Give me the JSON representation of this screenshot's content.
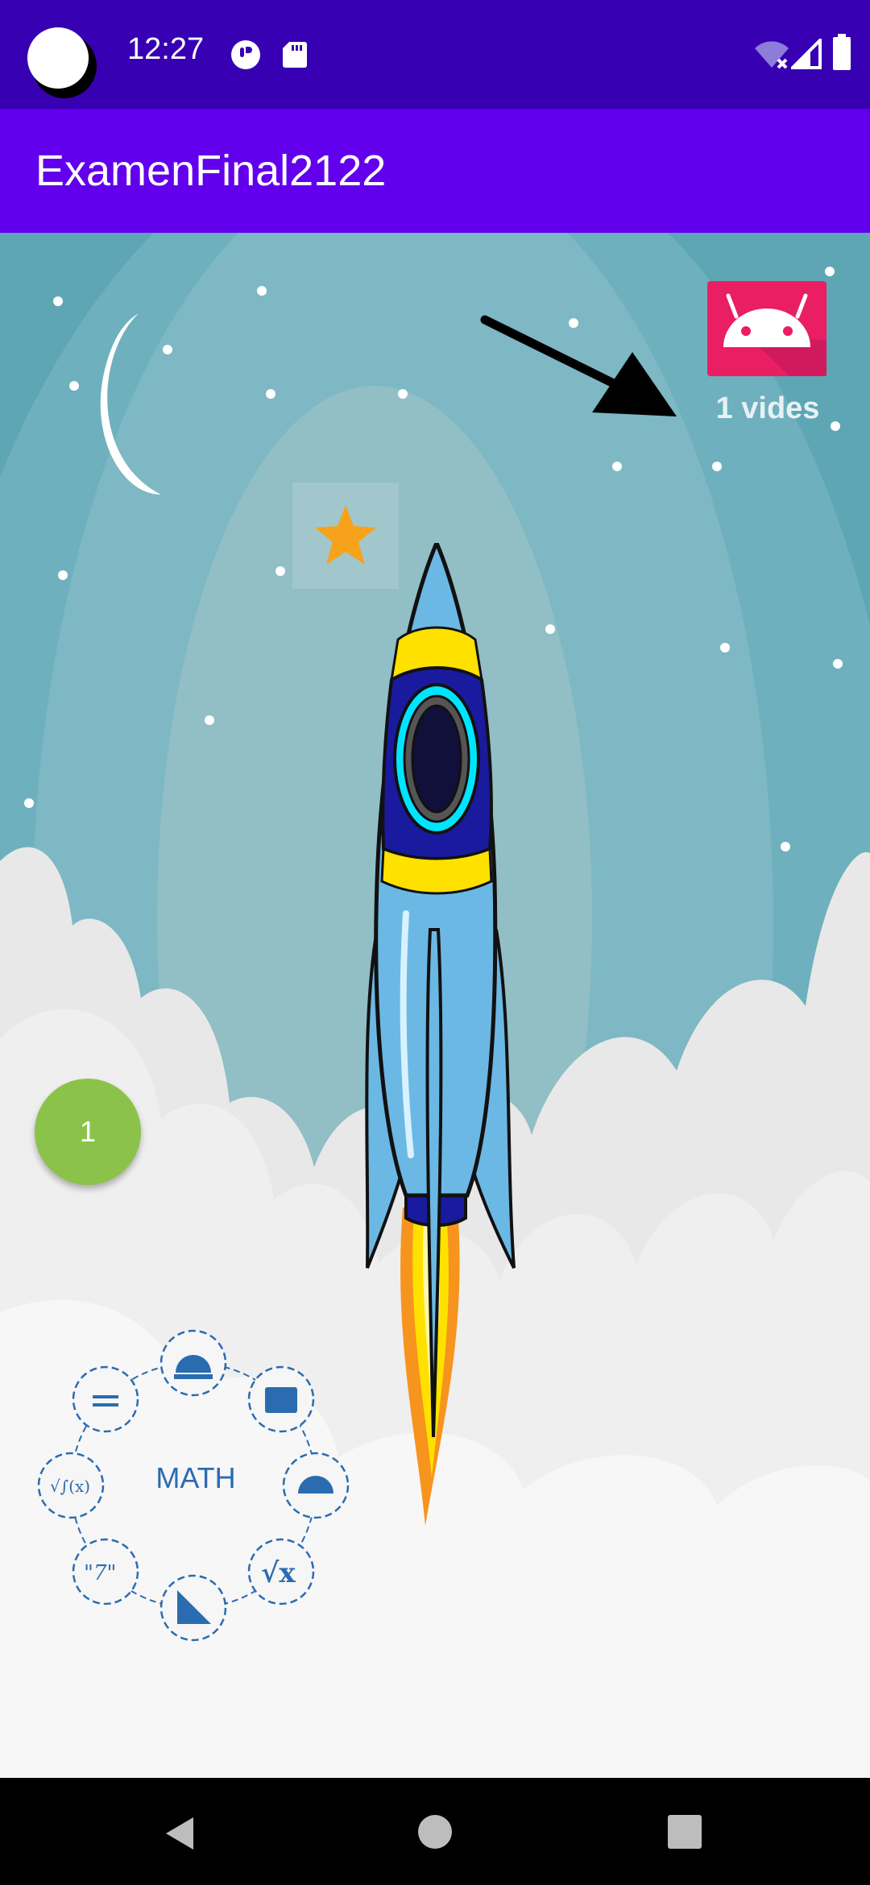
{
  "status_bar": {
    "time": "12:27",
    "icons": [
      "camera-cutout",
      "media-app-icon",
      "sd-card-icon",
      "wifi-off-icon",
      "cell-signal-icon",
      "battery-icon"
    ]
  },
  "app_bar": {
    "title": "ExamenFinal2122"
  },
  "game": {
    "lives_label": "1 vides",
    "counter": "1",
    "math_widget_label": "MATH",
    "colors": {
      "sky": "#5ea6b4",
      "counter_badge": "#8bc34a",
      "android_tile": "#e91e63",
      "star": "#f7a21b",
      "math_blue": "#2b6cb0"
    }
  },
  "nav_bar": {
    "buttons": [
      "back",
      "home",
      "recents"
    ]
  }
}
